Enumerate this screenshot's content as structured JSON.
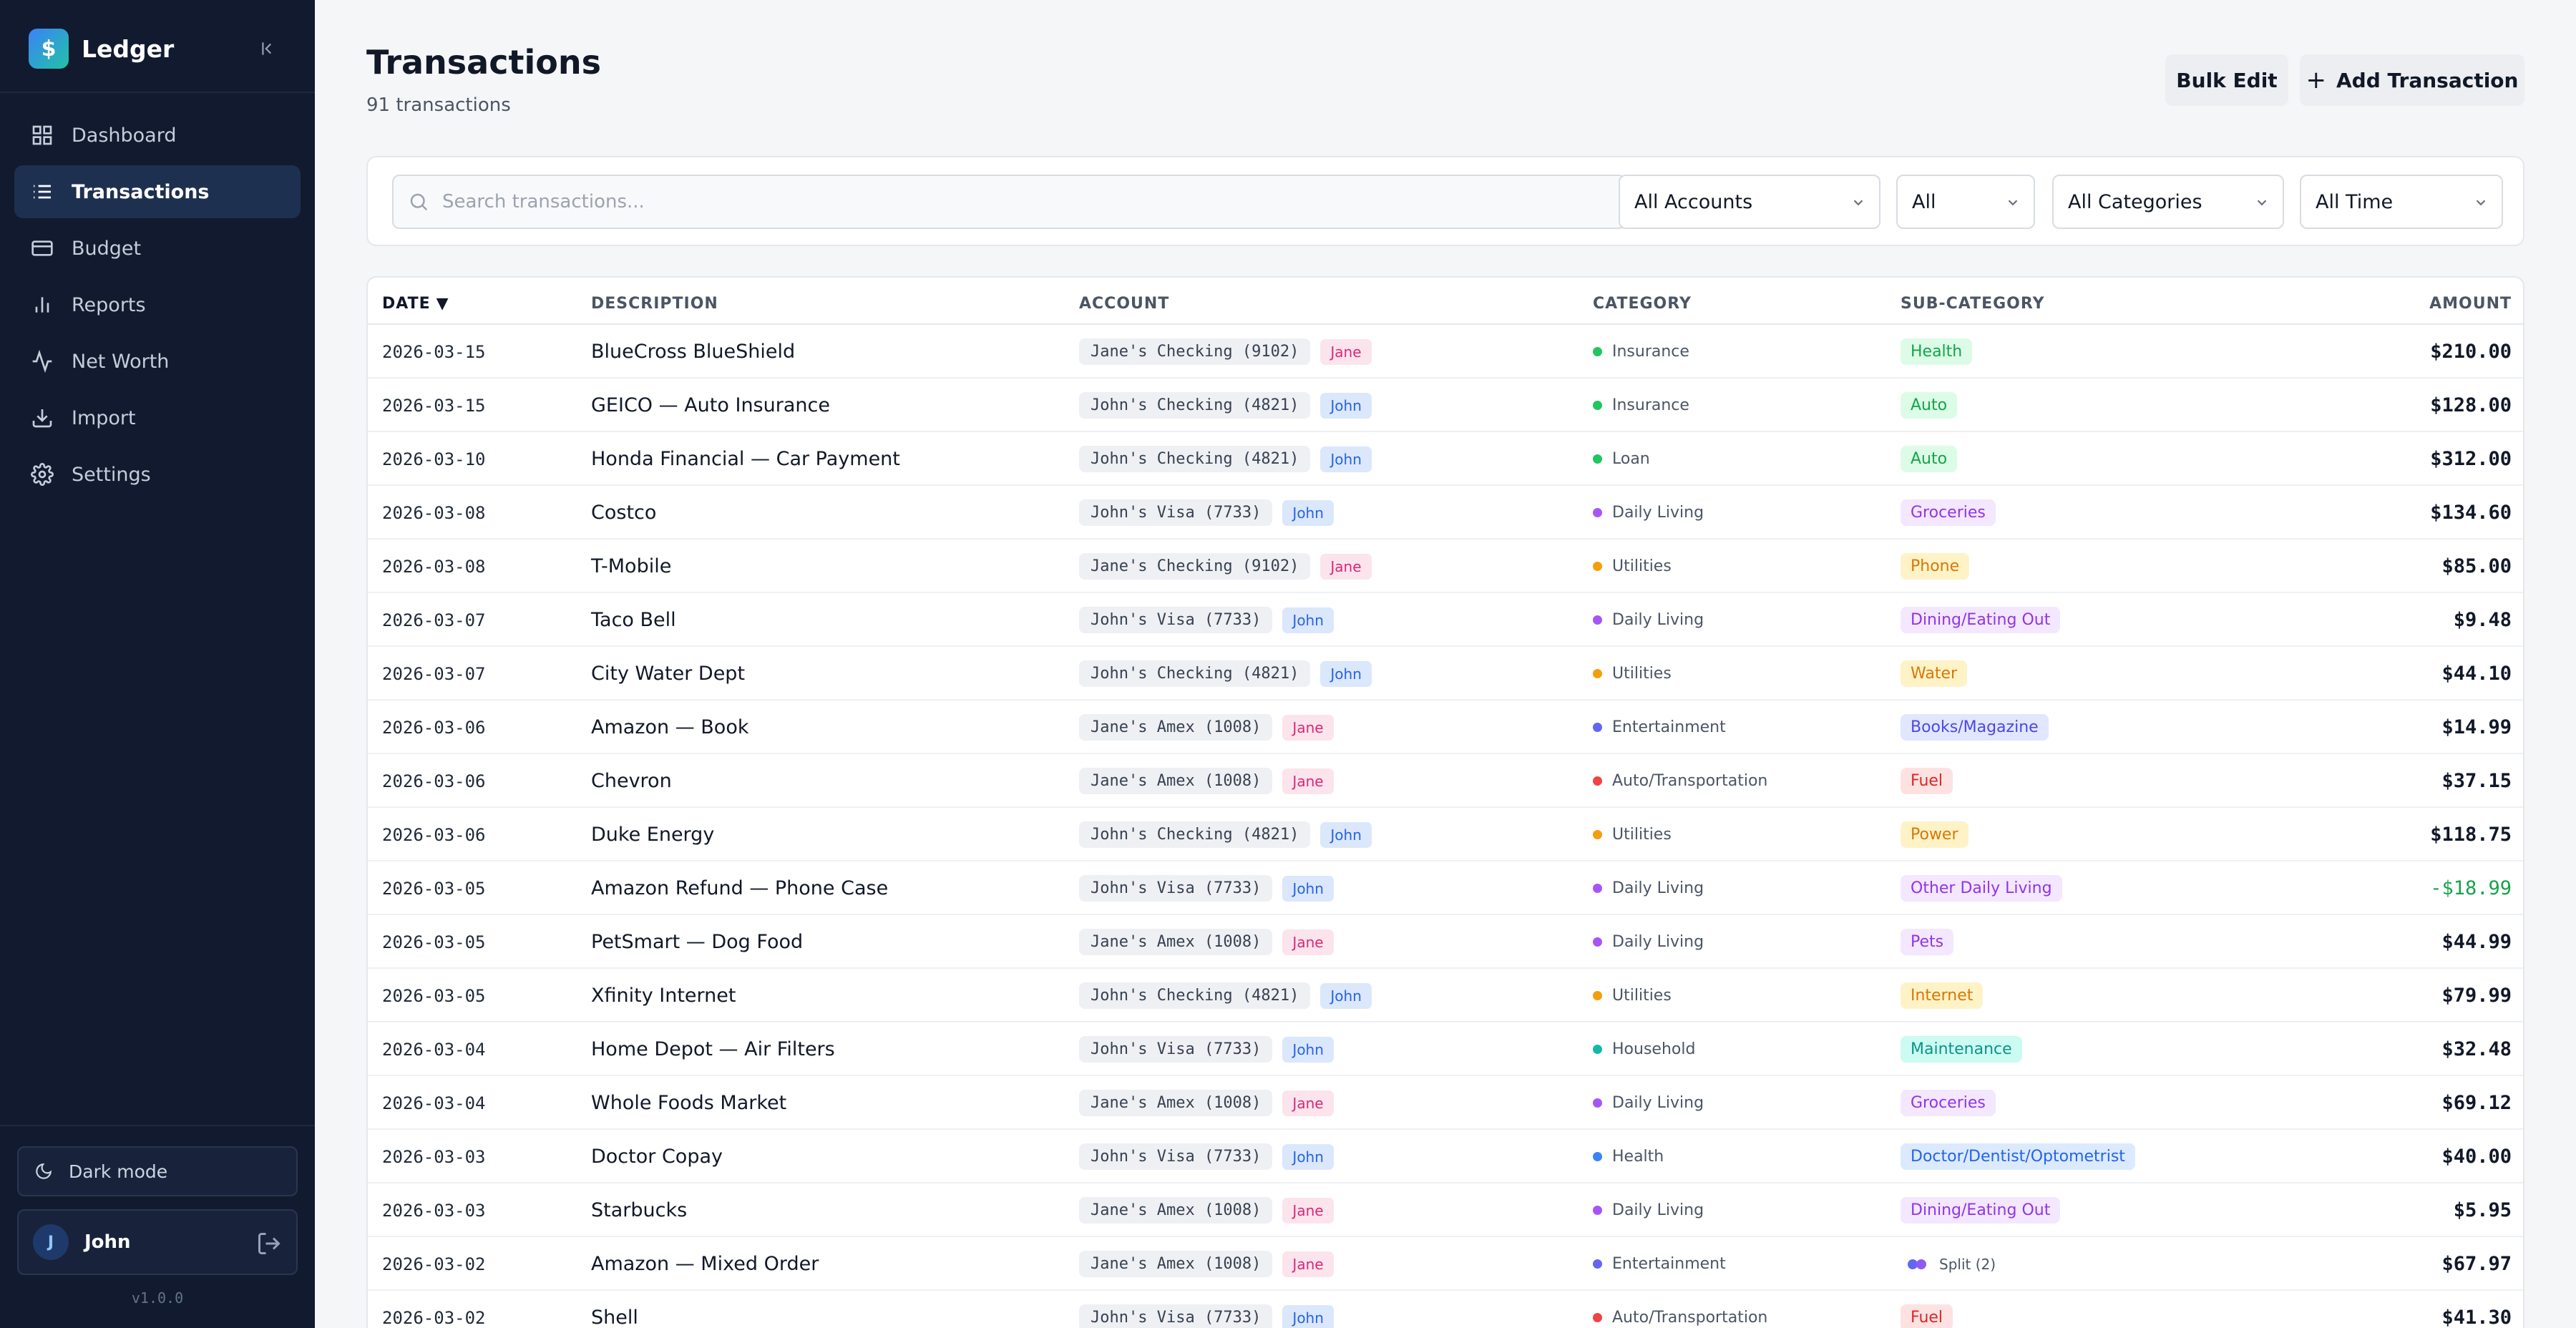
{
  "app": {
    "name": "Ledger",
    "logo_glyph": "$",
    "version": "v1.0.0"
  },
  "sidebar": {
    "items": [
      {
        "label": "Dashboard",
        "icon": "grid-icon",
        "active": false
      },
      {
        "label": "Transactions",
        "icon": "list-icon",
        "active": true
      },
      {
        "label": "Budget",
        "icon": "credit-card-icon",
        "active": false
      },
      {
        "label": "Reports",
        "icon": "bar-chart-icon",
        "active": false
      },
      {
        "label": "Net Worth",
        "icon": "activity-icon",
        "active": false
      },
      {
        "label": "Import",
        "icon": "download-icon",
        "active": false
      },
      {
        "label": "Settings",
        "icon": "gear-icon",
        "active": false
      }
    ],
    "dark_mode_label": "Dark mode",
    "user": {
      "initial": "J",
      "name": "John"
    }
  },
  "header": {
    "title": "Transactions",
    "subtitle": "91 transactions",
    "bulk_edit_label": "Bulk Edit",
    "add_label": "Add Transaction"
  },
  "filters": {
    "search_placeholder": "Search transactions...",
    "account": "All Accounts",
    "owner": "All",
    "category": "All Categories",
    "time": "All Time"
  },
  "table": {
    "columns": {
      "date": "DATE",
      "sort_arrow": "▼",
      "description": "DESCRIPTION",
      "account": "ACCOUNT",
      "category": "CATEGORY",
      "subcategory": "SUB-CATEGORY",
      "amount": "AMOUNT"
    },
    "rows": [
      {
        "date": "2026-03-15",
        "description": "BlueCross BlueShield",
        "account": "Jane's Checking (9102)",
        "owner": "Jane",
        "category": "Insurance",
        "subcategory": "Health",
        "amount": "$210.00"
      },
      {
        "date": "2026-03-15",
        "description": "GEICO — Auto Insurance",
        "account": "John's Checking (4821)",
        "owner": "John",
        "category": "Insurance",
        "subcategory": "Auto",
        "amount": "$128.00"
      },
      {
        "date": "2026-03-10",
        "description": "Honda Financial — Car Payment",
        "account": "John's Checking (4821)",
        "owner": "John",
        "category": "Loan",
        "subcategory": "Auto",
        "amount": "$312.00"
      },
      {
        "date": "2026-03-08",
        "description": "Costco",
        "account": "John's Visa (7733)",
        "owner": "John",
        "category": "Daily Living",
        "subcategory": "Groceries",
        "amount": "$134.60"
      },
      {
        "date": "2026-03-08",
        "description": "T-Mobile",
        "account": "Jane's Checking (9102)",
        "owner": "Jane",
        "category": "Utilities",
        "subcategory": "Phone",
        "amount": "$85.00"
      },
      {
        "date": "2026-03-07",
        "description": "Taco Bell",
        "account": "John's Visa (7733)",
        "owner": "John",
        "category": "Daily Living",
        "subcategory": "Dining/Eating Out",
        "amount": "$9.48"
      },
      {
        "date": "2026-03-07",
        "description": "City Water Dept",
        "account": "John's Checking (4821)",
        "owner": "John",
        "category": "Utilities",
        "subcategory": "Water",
        "amount": "$44.10"
      },
      {
        "date": "2026-03-06",
        "description": "Amazon — Book",
        "account": "Jane's Amex (1008)",
        "owner": "Jane",
        "category": "Entertainment",
        "subcategory": "Books/Magazine",
        "amount": "$14.99"
      },
      {
        "date": "2026-03-06",
        "description": "Chevron",
        "account": "Jane's Amex (1008)",
        "owner": "Jane",
        "category": "Auto/Transportation",
        "subcategory": "Fuel",
        "amount": "$37.15"
      },
      {
        "date": "2026-03-06",
        "description": "Duke Energy",
        "account": "John's Checking (4821)",
        "owner": "John",
        "category": "Utilities",
        "subcategory": "Power",
        "amount": "$118.75"
      },
      {
        "date": "2026-03-05",
        "description": "Amazon Refund — Phone Case",
        "account": "John's Visa (7733)",
        "owner": "John",
        "category": "Daily Living",
        "subcategory": "Other Daily Living",
        "amount": "-$18.99",
        "negative": true
      },
      {
        "date": "2026-03-05",
        "description": "PetSmart — Dog Food",
        "account": "Jane's Amex (1008)",
        "owner": "Jane",
        "category": "Daily Living",
        "subcategory": "Pets",
        "amount": "$44.99"
      },
      {
        "date": "2026-03-05",
        "description": "Xfinity Internet",
        "account": "John's Checking (4821)",
        "owner": "John",
        "category": "Utilities",
        "subcategory": "Internet",
        "amount": "$79.99"
      },
      {
        "date": "2026-03-04",
        "description": "Home Depot — Air Filters",
        "account": "John's Visa (7733)",
        "owner": "John",
        "category": "Household",
        "subcategory": "Maintenance",
        "amount": "$32.48"
      },
      {
        "date": "2026-03-04",
        "description": "Whole Foods Market",
        "account": "Jane's Amex (1008)",
        "owner": "Jane",
        "category": "Daily Living",
        "subcategory": "Groceries",
        "amount": "$69.12"
      },
      {
        "date": "2026-03-03",
        "description": "Doctor Copay",
        "account": "John's Visa (7733)",
        "owner": "John",
        "category": "Health",
        "subcategory": "Doctor/Dentist/Optometrist",
        "amount": "$40.00"
      },
      {
        "date": "2026-03-03",
        "description": "Starbucks",
        "account": "Jane's Amex (1008)",
        "owner": "Jane",
        "category": "Daily Living",
        "subcategory": "Dining/Eating Out",
        "amount": "$5.95"
      },
      {
        "date": "2026-03-02",
        "description": "Amazon — Mixed Order",
        "account": "Jane's Amex (1008)",
        "owner": "Jane",
        "category": "Entertainment",
        "subcategory": "Split (2)",
        "split": true,
        "amount": "$67.97"
      },
      {
        "date": "2026-03-02",
        "description": "Shell",
        "account": "John's Visa (7733)",
        "owner": "John",
        "category": "Auto/Transportation",
        "subcategory": "Fuel",
        "amount": "$41.30"
      }
    ]
  },
  "colors": {
    "Insurance": {
      "dot": "#22c55e",
      "bg": "#dcfce7",
      "fg": "#16a34a"
    },
    "Loan": {
      "dot": "#22c55e",
      "bg": "#dcfce7",
      "fg": "#16a34a"
    },
    "Daily Living": {
      "dot": "#a855f7",
      "bg": "#f3e8ff",
      "fg": "#9333ea"
    },
    "Utilities": {
      "dot": "#f59e0b",
      "bg": "#fef3c7",
      "fg": "#d97706"
    },
    "Entertainment": {
      "dot": "#6366f1",
      "bg": "#e0e7ff",
      "fg": "#4f46e5"
    },
    "Auto/Transportation": {
      "dot": "#ef4444",
      "bg": "#fee2e2",
      "fg": "#dc2626"
    },
    "Household": {
      "dot": "#14b8a6",
      "bg": "#ccfbf1",
      "fg": "#0d9488"
    },
    "Health": {
      "dot": "#3b82f6",
      "bg": "#dbeafe",
      "fg": "#2563eb"
    }
  }
}
